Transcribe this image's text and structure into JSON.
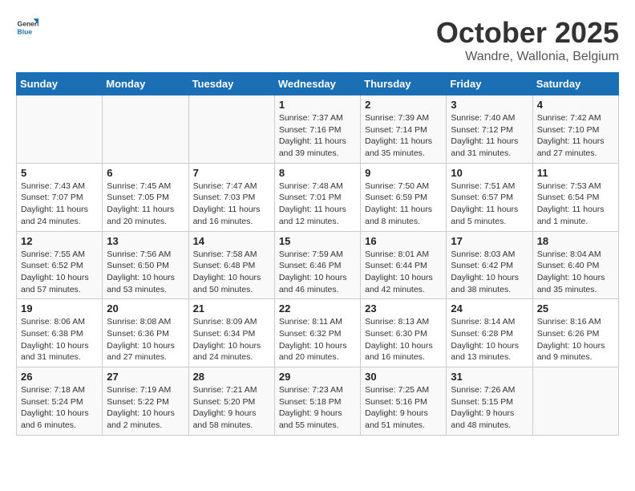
{
  "header": {
    "logo_line1": "General",
    "logo_line2": "Blue",
    "month": "October 2025",
    "location": "Wandre, Wallonia, Belgium"
  },
  "weekdays": [
    "Sunday",
    "Monday",
    "Tuesday",
    "Wednesday",
    "Thursday",
    "Friday",
    "Saturday"
  ],
  "weeks": [
    [
      {
        "day": "",
        "info": ""
      },
      {
        "day": "",
        "info": ""
      },
      {
        "day": "",
        "info": ""
      },
      {
        "day": "1",
        "info": "Sunrise: 7:37 AM\nSunset: 7:16 PM\nDaylight: 11 hours\nand 39 minutes."
      },
      {
        "day": "2",
        "info": "Sunrise: 7:39 AM\nSunset: 7:14 PM\nDaylight: 11 hours\nand 35 minutes."
      },
      {
        "day": "3",
        "info": "Sunrise: 7:40 AM\nSunset: 7:12 PM\nDaylight: 11 hours\nand 31 minutes."
      },
      {
        "day": "4",
        "info": "Sunrise: 7:42 AM\nSunset: 7:10 PM\nDaylight: 11 hours\nand 27 minutes."
      }
    ],
    [
      {
        "day": "5",
        "info": "Sunrise: 7:43 AM\nSunset: 7:07 PM\nDaylight: 11 hours\nand 24 minutes."
      },
      {
        "day": "6",
        "info": "Sunrise: 7:45 AM\nSunset: 7:05 PM\nDaylight: 11 hours\nand 20 minutes."
      },
      {
        "day": "7",
        "info": "Sunrise: 7:47 AM\nSunset: 7:03 PM\nDaylight: 11 hours\nand 16 minutes."
      },
      {
        "day": "8",
        "info": "Sunrise: 7:48 AM\nSunset: 7:01 PM\nDaylight: 11 hours\nand 12 minutes."
      },
      {
        "day": "9",
        "info": "Sunrise: 7:50 AM\nSunset: 6:59 PM\nDaylight: 11 hours\nand 8 minutes."
      },
      {
        "day": "10",
        "info": "Sunrise: 7:51 AM\nSunset: 6:57 PM\nDaylight: 11 hours\nand 5 minutes."
      },
      {
        "day": "11",
        "info": "Sunrise: 7:53 AM\nSunset: 6:54 PM\nDaylight: 11 hours\nand 1 minute."
      }
    ],
    [
      {
        "day": "12",
        "info": "Sunrise: 7:55 AM\nSunset: 6:52 PM\nDaylight: 10 hours\nand 57 minutes."
      },
      {
        "day": "13",
        "info": "Sunrise: 7:56 AM\nSunset: 6:50 PM\nDaylight: 10 hours\nand 53 minutes."
      },
      {
        "day": "14",
        "info": "Sunrise: 7:58 AM\nSunset: 6:48 PM\nDaylight: 10 hours\nand 50 minutes."
      },
      {
        "day": "15",
        "info": "Sunrise: 7:59 AM\nSunset: 6:46 PM\nDaylight: 10 hours\nand 46 minutes."
      },
      {
        "day": "16",
        "info": "Sunrise: 8:01 AM\nSunset: 6:44 PM\nDaylight: 10 hours\nand 42 minutes."
      },
      {
        "day": "17",
        "info": "Sunrise: 8:03 AM\nSunset: 6:42 PM\nDaylight: 10 hours\nand 38 minutes."
      },
      {
        "day": "18",
        "info": "Sunrise: 8:04 AM\nSunset: 6:40 PM\nDaylight: 10 hours\nand 35 minutes."
      }
    ],
    [
      {
        "day": "19",
        "info": "Sunrise: 8:06 AM\nSunset: 6:38 PM\nDaylight: 10 hours\nand 31 minutes."
      },
      {
        "day": "20",
        "info": "Sunrise: 8:08 AM\nSunset: 6:36 PM\nDaylight: 10 hours\nand 27 minutes."
      },
      {
        "day": "21",
        "info": "Sunrise: 8:09 AM\nSunset: 6:34 PM\nDaylight: 10 hours\nand 24 minutes."
      },
      {
        "day": "22",
        "info": "Sunrise: 8:11 AM\nSunset: 6:32 PM\nDaylight: 10 hours\nand 20 minutes."
      },
      {
        "day": "23",
        "info": "Sunrise: 8:13 AM\nSunset: 6:30 PM\nDaylight: 10 hours\nand 16 minutes."
      },
      {
        "day": "24",
        "info": "Sunrise: 8:14 AM\nSunset: 6:28 PM\nDaylight: 10 hours\nand 13 minutes."
      },
      {
        "day": "25",
        "info": "Sunrise: 8:16 AM\nSunset: 6:26 PM\nDaylight: 10 hours\nand 9 minutes."
      }
    ],
    [
      {
        "day": "26",
        "info": "Sunrise: 7:18 AM\nSunset: 5:24 PM\nDaylight: 10 hours\nand 6 minutes."
      },
      {
        "day": "27",
        "info": "Sunrise: 7:19 AM\nSunset: 5:22 PM\nDaylight: 10 hours\nand 2 minutes."
      },
      {
        "day": "28",
        "info": "Sunrise: 7:21 AM\nSunset: 5:20 PM\nDaylight: 9 hours\nand 58 minutes."
      },
      {
        "day": "29",
        "info": "Sunrise: 7:23 AM\nSunset: 5:18 PM\nDaylight: 9 hours\nand 55 minutes."
      },
      {
        "day": "30",
        "info": "Sunrise: 7:25 AM\nSunset: 5:16 PM\nDaylight: 9 hours\nand 51 minutes."
      },
      {
        "day": "31",
        "info": "Sunrise: 7:26 AM\nSunset: 5:15 PM\nDaylight: 9 hours\nand 48 minutes."
      },
      {
        "day": "",
        "info": ""
      }
    ]
  ]
}
